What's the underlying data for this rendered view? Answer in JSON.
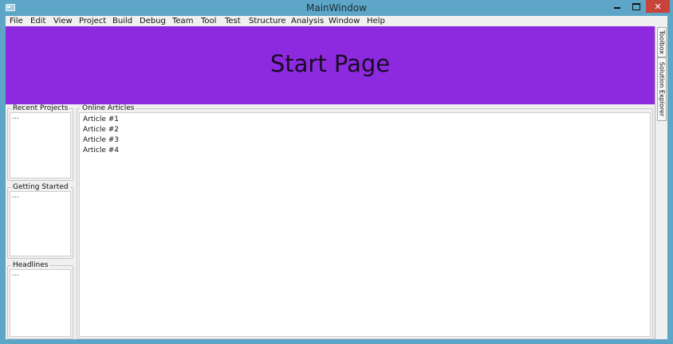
{
  "window": {
    "title": "MainWindow"
  },
  "menu": [
    "File",
    "Edit",
    "View",
    "Project",
    "Build",
    "Debug",
    "Team",
    "Tool",
    "Test",
    "Structure",
    "Analysis",
    "Window",
    "Help"
  ],
  "banner": {
    "title": "Start Page",
    "color": "#8d2ae0"
  },
  "side_tabs": [
    "Toolbox",
    "Solution Explorer"
  ],
  "groups": {
    "recent": {
      "title": "Recent Projects",
      "content": "..."
    },
    "getting_started": {
      "title": "Getting Started",
      "content": "..."
    },
    "headlines": {
      "title": "Headlines",
      "content": "..."
    },
    "online": {
      "title": "Online Articles",
      "items": [
        "Article #1",
        "Article #2",
        "Article #3",
        "Article #4"
      ]
    }
  }
}
